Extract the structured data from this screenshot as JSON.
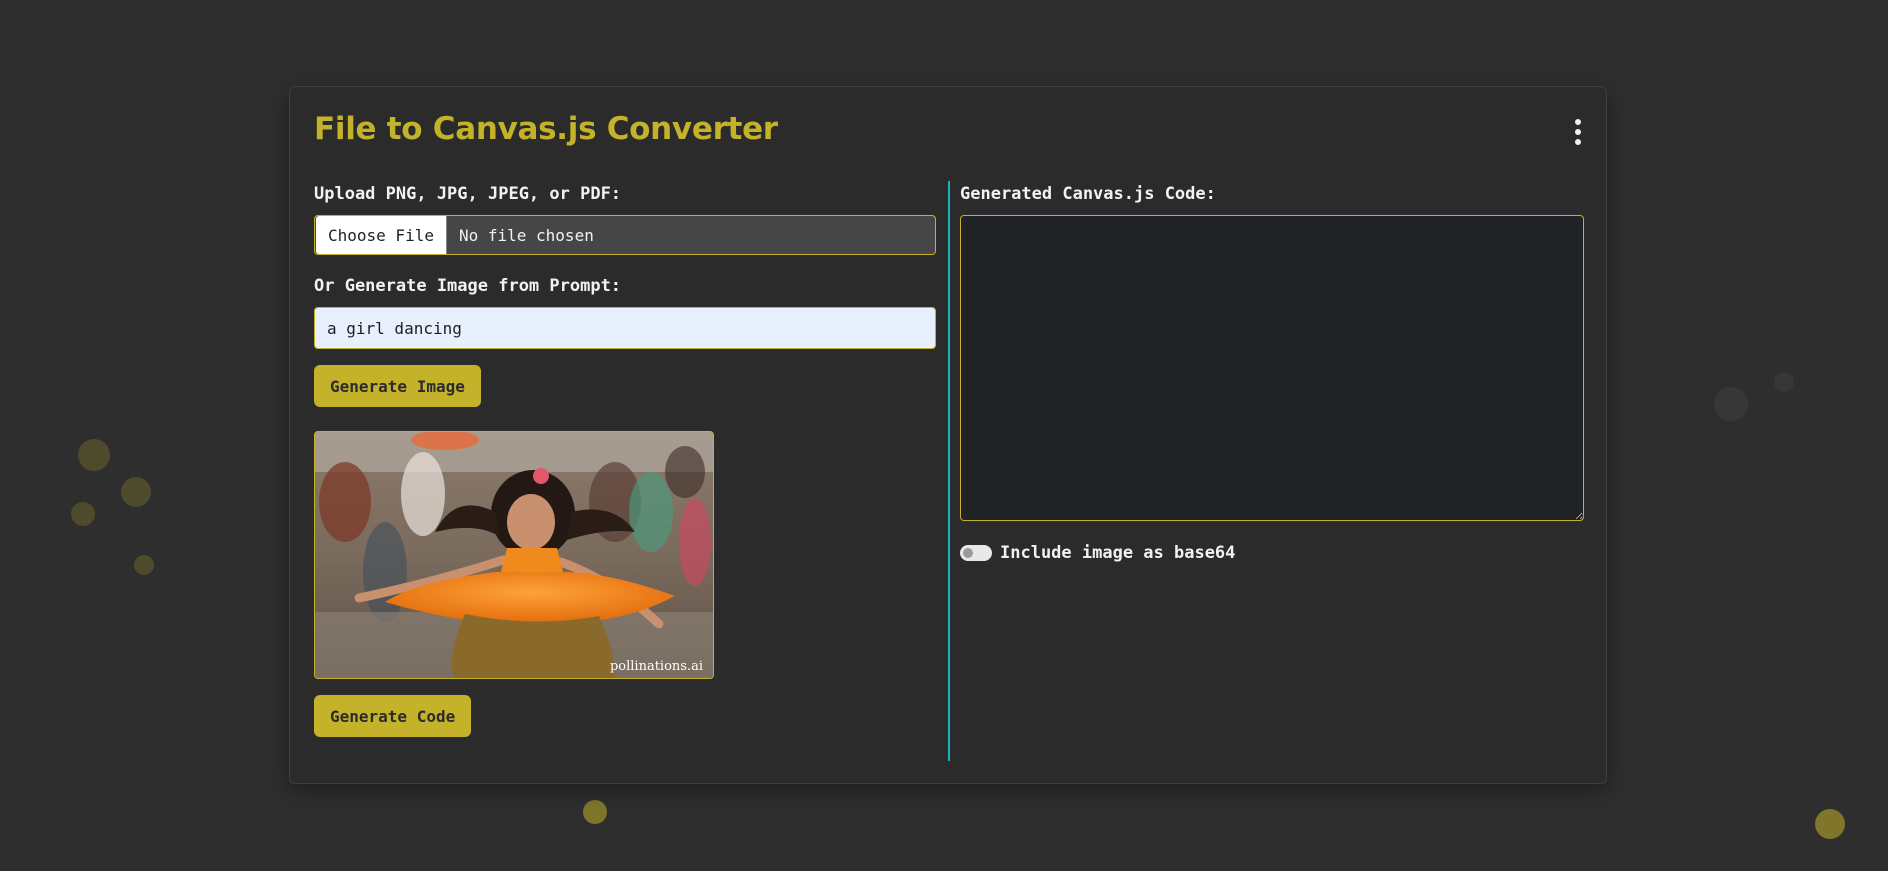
{
  "app": {
    "title": "File to Canvas.js Converter"
  },
  "upload": {
    "label": "Upload PNG, JPG, JPEG, or PDF:",
    "button_label": "Choose File",
    "status": "No file chosen"
  },
  "prompt": {
    "label": "Or Generate Image from Prompt:",
    "value": "a girl dancing"
  },
  "buttons": {
    "generate_image": "Generate Image",
    "generate_code": "Generate Code"
  },
  "preview": {
    "watermark": "pollinations.ai"
  },
  "output": {
    "label": "Generated Canvas.js Code:",
    "code": ""
  },
  "options": {
    "include_base64_label": "Include image as base64",
    "include_base64_enabled": false
  },
  "colors": {
    "accent": "#c4b22a",
    "divider": "#19b4b4",
    "background": "#2e2e2e"
  }
}
